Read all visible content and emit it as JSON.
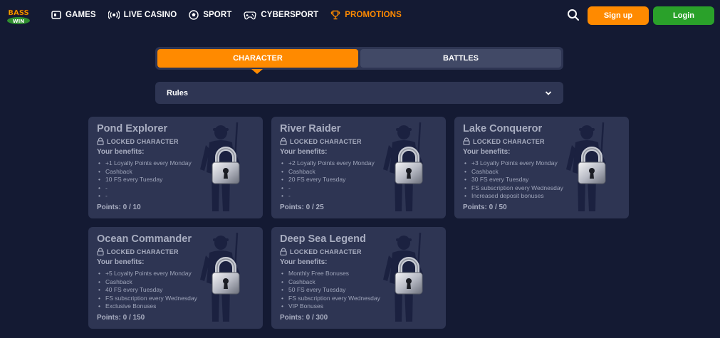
{
  "header": {
    "logo_alt": "BASS WIN",
    "nav": [
      {
        "label": "GAMES",
        "icon": "games-icon"
      },
      {
        "label": "LIVE CASINO",
        "icon": "live-casino-icon"
      },
      {
        "label": "SPORT",
        "icon": "sport-ball-icon"
      },
      {
        "label": "CYBERSPORT",
        "icon": "gamepad-icon"
      },
      {
        "label": "PROMOTIONS",
        "icon": "trophy-icon",
        "active": true
      }
    ],
    "signup_label": "Sign up",
    "login_label": "Login"
  },
  "tabs": [
    {
      "label": "CHARACTER",
      "active": true
    },
    {
      "label": "BATTLES",
      "active": false
    }
  ],
  "rules": {
    "label": "Rules"
  },
  "cards": [
    {
      "title": "Pond Explorer",
      "status": "LOCKED CHARACTER",
      "benefits_title": "Your benefits:",
      "benefits": [
        "+1 Loyalty Points every Monday",
        "Cashback",
        "10 FS every Tuesday",
        "-",
        "-"
      ],
      "points": "Points: 0 / 10"
    },
    {
      "title": "River Raider",
      "status": "LOCKED CHARACTER",
      "benefits_title": "Your benefits:",
      "benefits": [
        "+2 Loyalty Points every Monday",
        "Cashback",
        "20 FS every Tuesday",
        "-",
        "-"
      ],
      "points": "Points: 0 / 25"
    },
    {
      "title": "Lake Conqueror",
      "status": "LOCKED CHARACTER",
      "benefits_title": "Your benefits:",
      "benefits": [
        "+3 Loyalty Points every Monday",
        "Cashback",
        "30 FS every Tuesday",
        "FS subscription every Wednesday",
        "Increased deposit bonuses"
      ],
      "points": "Points: 0 / 50"
    },
    {
      "title": "Ocean Commander",
      "status": "LOCKED CHARACTER",
      "benefits_title": "Your benefits:",
      "benefits": [
        "+5 Loyalty Points every Monday",
        "Cashback",
        "40 FS every Tuesday",
        "FS subscription every Wednesday",
        "Exclusive Bonuses"
      ],
      "points": "Points: 0 / 150"
    },
    {
      "title": "Deep Sea Legend",
      "status": "LOCKED CHARACTER",
      "benefits_title": "Your benefits:",
      "benefits": [
        "Monthly Free Bonuses",
        "Cashback",
        "50 FS every Tuesday",
        "FS subscription every Wednesday",
        "VIP Bonuses"
      ],
      "points": "Points: 0 / 300"
    }
  ],
  "colors": {
    "background": "#141a33",
    "panel": "#2e3553",
    "accent": "#ff8a00",
    "login": "#2aa12a"
  }
}
